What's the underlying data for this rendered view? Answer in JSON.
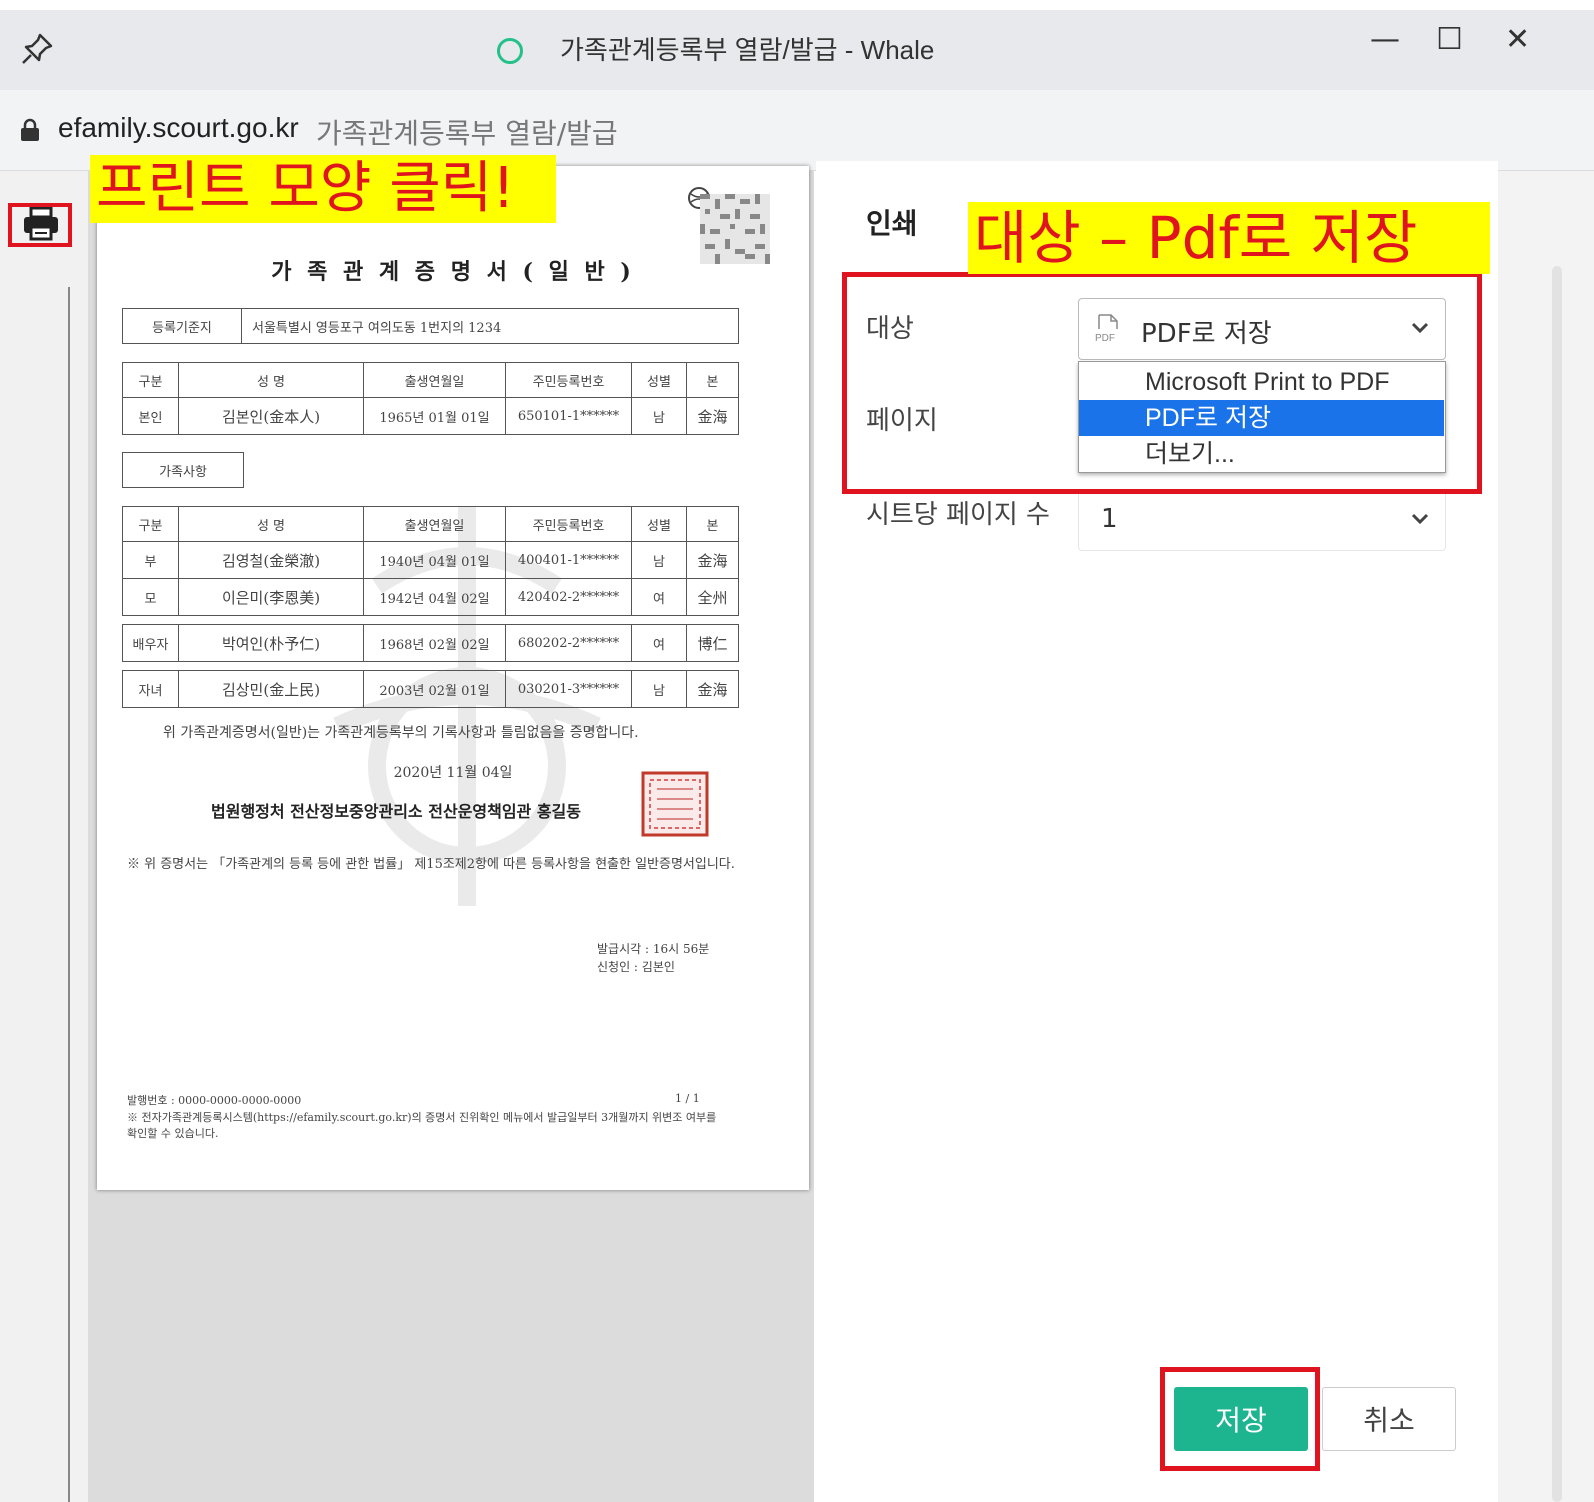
{
  "window": {
    "title": "가족관계등록부 열람/발급 - Whale",
    "minimize_label": "—",
    "maximize_label": "☐",
    "close_label": "✕"
  },
  "address": {
    "domain": "efamily.scourt.go.kr",
    "path": "가족관계등록부 열람/발급"
  },
  "document": {
    "title": "가 족 관 계 증 명 서 ( 일 반 )",
    "reg_base_label": "등록기준지",
    "reg_base_value": "서울특별시 영등포구 여의도동 1번지의 1234",
    "headers": [
      "구분",
      "성 명",
      "출생연월일",
      "주민등록번호",
      "성별",
      "본"
    ],
    "self_row": [
      "본인",
      "김본인(金本人)",
      "1965년 01월 01일",
      "650101-1******",
      "남",
      "金海"
    ],
    "family_label": "가족사항",
    "family_rows": [
      [
        "부",
        "김영철(金榮澈)",
        "1940년 04월 01일",
        "400401-1******",
        "남",
        "金海"
      ],
      [
        "모",
        "이은미(李恩美)",
        "1942년 04월 02일",
        "420402-2******",
        "여",
        "全州"
      ],
      [
        "배우자",
        "박여인(朴予仁)",
        "1968년 02월 02일",
        "680202-2******",
        "여",
        "博仁"
      ],
      [
        "자녀",
        "김상민(金上民)",
        "2003년 02월 01일",
        "030201-3******",
        "남",
        "金海"
      ]
    ],
    "certify_text": "위 가족관계증명서(일반)는 가족관계등록부의 기록사항과 틀림없음을 증명합니다.",
    "issue_date": "2020년 11월 04일",
    "issuer": "법원행정처 전산정보중앙관리소 전산운영책임관 홍길동",
    "note": "※ 위 증명서는 「가족관계의 등록 등에 관한 법률」 제15조제2항에 따른 등록사항을 현출한 일반증명서입니다.",
    "issue_time": "발급시각 : 16시 56분",
    "applicant": "신청인 : 김본인",
    "issue_no": "발행번호 : 0000-0000-0000-0000",
    "page_no": "1 / 1",
    "footer_note": "※ 전자가족관계등록시스템(https://efamily.scourt.go.kr)의 증명서 진위확인 메뉴에서 발급일부터 3개월까지 위변조 여부를 확인할 수 있습니다."
  },
  "print": {
    "heading": "인쇄",
    "destination_label": "대상",
    "destination_value": "PDF로 저장",
    "destination_options": [
      "Microsoft Print to PDF",
      "PDF로 저장",
      "더보기..."
    ],
    "pages_label": "페이지",
    "sheets_label": "시트당 페이지 수",
    "sheets_value": "1",
    "save_label": "저장",
    "cancel_label": "취소"
  },
  "annotations": {
    "print_hint": "프린트 모양 클릭!",
    "destination_hint": "대상 – Pdf로 저장"
  },
  "colors": {
    "accent_green": "#1db58f",
    "highlight_red": "#e0141e",
    "annotation_yellow": "#ffff00",
    "selected_blue": "#1a73e8"
  }
}
